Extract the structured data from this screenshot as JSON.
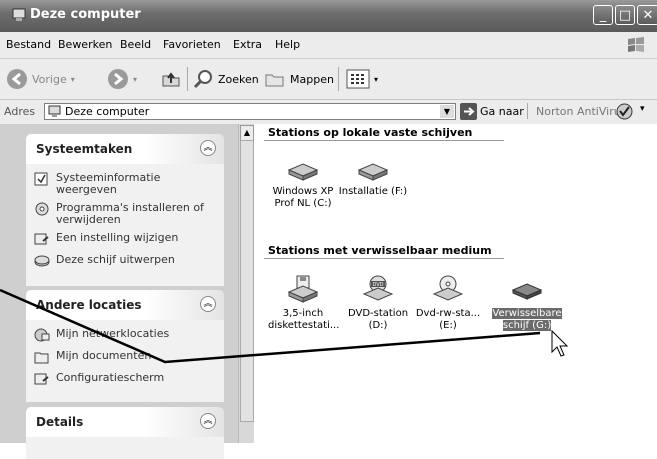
{
  "window": {
    "title": "Deze computer"
  },
  "menu": [
    "Bestand",
    "Bewerken",
    "Beeld",
    "Favorieten",
    "Extra",
    "Help"
  ],
  "toolbar": {
    "back": "Vorige",
    "search": "Zoeken",
    "folders": "Mappen"
  },
  "address": {
    "label": "Adres",
    "value": "Deze computer",
    "go": "Ga naar",
    "norton": "Norton AntiVirus"
  },
  "sidebar": {
    "system_tasks": {
      "title": "Systeemtaken",
      "items": [
        "Systeeminformatie weergeven",
        "Programma's installeren of verwijderen",
        "Een instelling wijzigen",
        "Deze schijf uitwerpen"
      ]
    },
    "other_places": {
      "title": "Andere locaties",
      "items": [
        "Mijn netwerklocaties",
        "Mijn documenten",
        "Configuratiescherm"
      ]
    },
    "details": {
      "title": "Details"
    }
  },
  "main": {
    "fixed_section": "Stations op lokale vaste schijven",
    "fixed_drives": [
      "Windows XP Prof NL (C:)",
      "Installatie (F:)"
    ],
    "removable_section": "Stations met verwisselbaar medium",
    "removable_drives": [
      "3,5-inch diskettestati...",
      "DVD-station (D:)",
      "Dvd-rw-sta... (E:)",
      "Verwisselbare schijf (G:)"
    ]
  }
}
